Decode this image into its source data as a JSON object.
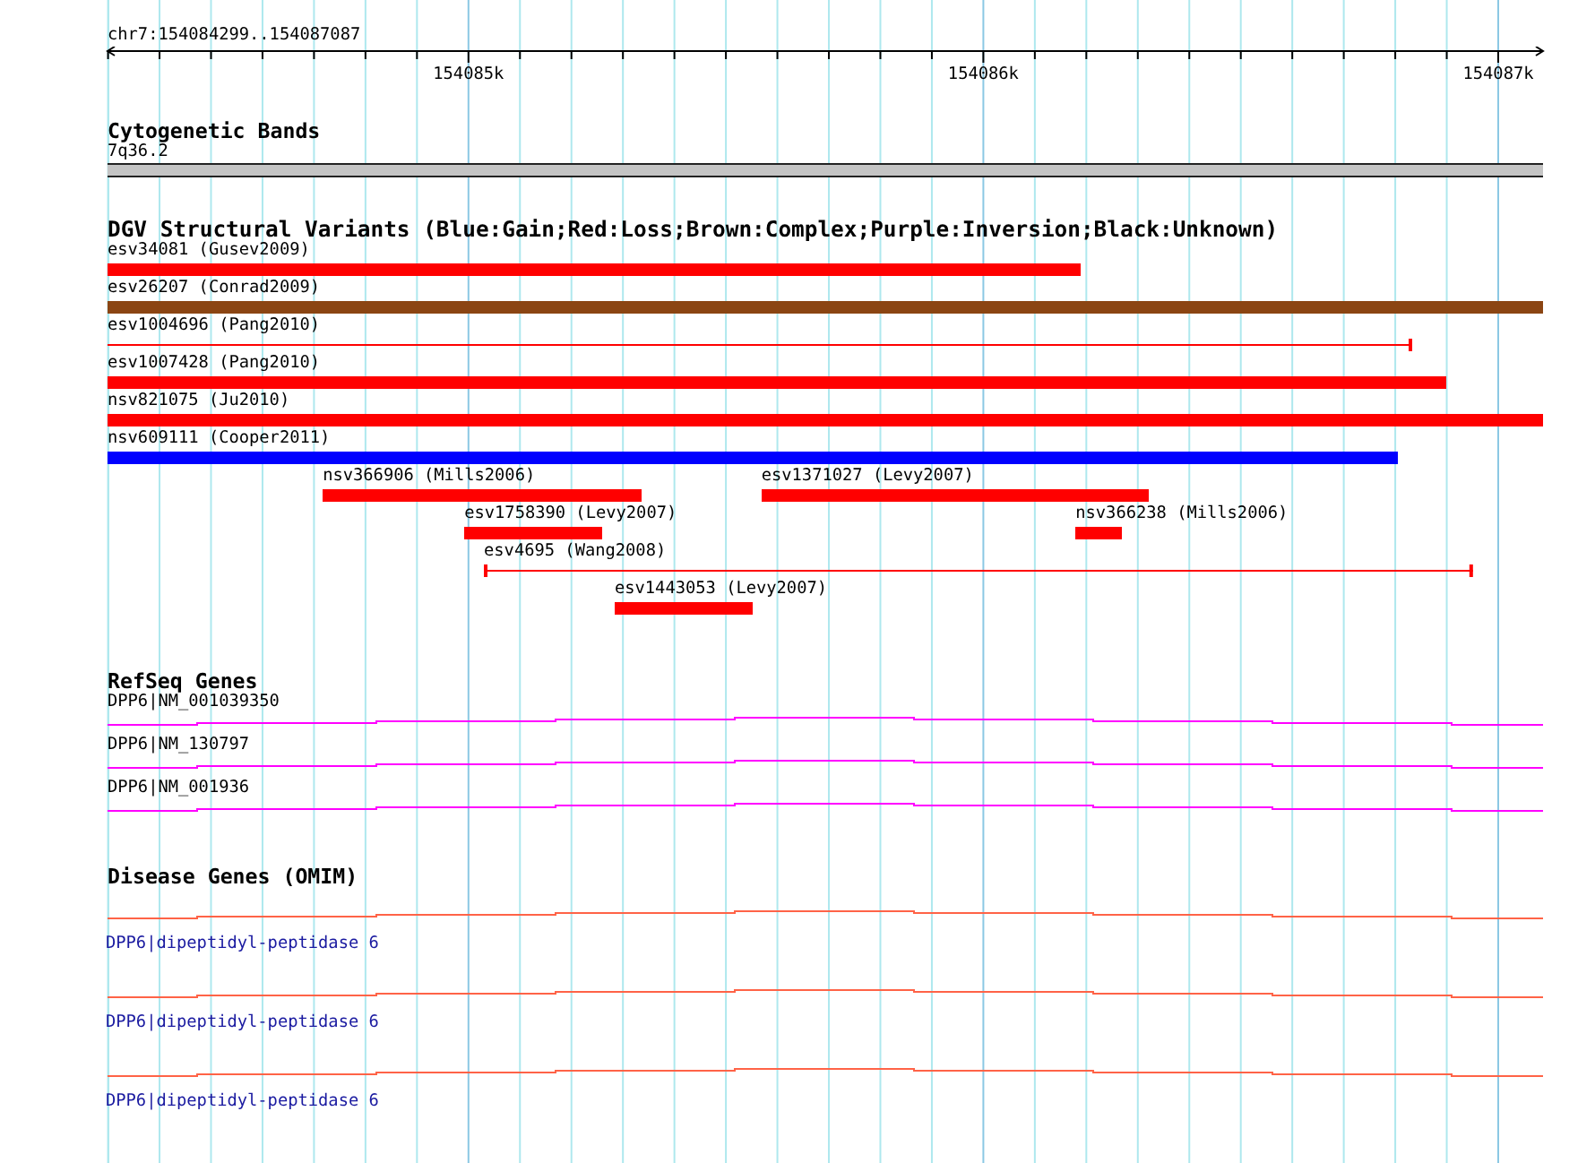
{
  "ruler": {
    "region": "chr7:154084299..154087087",
    "ticks": [
      {
        "label": "154085k"
      },
      {
        "label": "154086k"
      },
      {
        "label": "154087k"
      }
    ]
  },
  "tracks": [
    {
      "kind": "bands",
      "title": "Cytogenetic Bands",
      "features": [
        {
          "label": "7q36.2"
        }
      ]
    },
    {
      "kind": "variants",
      "title": "DGV Structural Variants (Blue:Gain;Red:Loss;Brown:Complex;Purple:Inversion;Black:Unknown)",
      "rows": [
        [
          {
            "label": "esv34081 (Gusev2009)",
            "kind": "bar",
            "color": "#ff0000"
          }
        ],
        [
          {
            "label": "esv26207 (Conrad2009)",
            "kind": "bar",
            "color": "#8b4513"
          }
        ],
        [
          {
            "label": "esv1004696 (Pang2010)",
            "kind": "line",
            "color": "#ff0000"
          }
        ],
        [
          {
            "label": "esv1007428 (Pang2010)",
            "kind": "bar",
            "color": "#ff0000"
          }
        ],
        [
          {
            "label": "nsv821075 (Ju2010)",
            "kind": "bar",
            "color": "#ff0000"
          }
        ],
        [
          {
            "label": "nsv609111 (Cooper2011)",
            "kind": "bar",
            "color": "#0000ff"
          }
        ],
        [
          {
            "label": "nsv366906 (Mills2006)",
            "kind": "bar",
            "color": "#ff0000"
          },
          {
            "label": "esv1371027 (Levy2007)",
            "kind": "bar",
            "color": "#ff0000"
          }
        ],
        [
          {
            "label": "esv1758390 (Levy2007)",
            "kind": "bar",
            "color": "#ff0000"
          },
          {
            "label": "nsv366238 (Mills2006)",
            "kind": "bar",
            "color": "#ff0000"
          }
        ],
        [
          {
            "label": "esv4695 (Wang2008)",
            "kind": "line",
            "color": "#ff0000"
          }
        ],
        [
          {
            "label": "esv1443053 (Levy2007)",
            "kind": "bar",
            "color": "#ff0000"
          }
        ]
      ]
    },
    {
      "kind": "genes",
      "title": "RefSeq Genes",
      "features": [
        {
          "label": "DPP6|NM_001039350"
        },
        {
          "label": "DPP6|NM_130797"
        },
        {
          "label": "DPP6|NM_001936"
        }
      ]
    },
    {
      "kind": "disease",
      "title": "Disease Genes (OMIM)",
      "features": [
        {
          "label": "DPP6|dipeptidyl-peptidase 6"
        },
        {
          "label": "DPP6|dipeptidyl-peptidase 6"
        },
        {
          "label": "DPP6|dipeptidyl-peptidase 6"
        }
      ]
    }
  ]
}
